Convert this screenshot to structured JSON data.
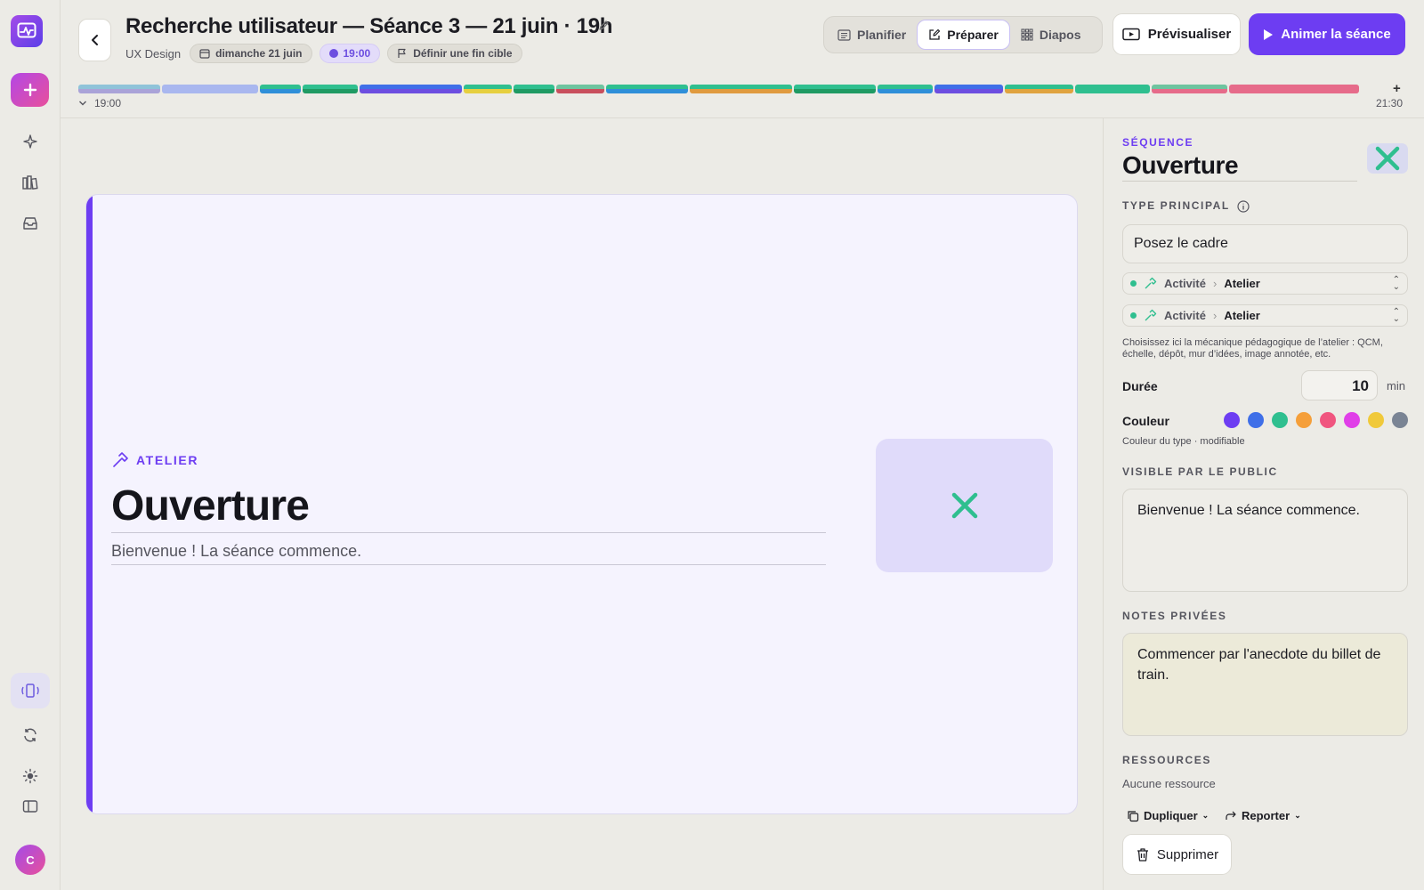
{
  "header": {
    "title": "Recherche utilisateur — Séance 3 — 21 juin · 19h",
    "course": "UX Design",
    "date_chip": "dimanche 21 juin",
    "time_chip": "19:00",
    "target_chip": "Définir une fin cible",
    "modes": [
      {
        "label": "Planifier",
        "icon": "list-icon",
        "active": false
      },
      {
        "label": "Préparer",
        "icon": "edit-icon",
        "active": true
      },
      {
        "label": "Diapos",
        "icon": "grid-icon",
        "active": false
      }
    ],
    "preview_label": "Prévisualiser",
    "animate_label": "Animer la séance"
  },
  "timeline": {
    "start": "19:00",
    "end": "21:30",
    "segments": [
      {
        "top": "#8fc3d9",
        "bottom": "#aaa3d8",
        "weight": 6
      },
      {
        "top": "#a9b7ef",
        "bottom": "#a9b7ef",
        "weight": 7
      },
      {
        "top": "#2fbf8f",
        "bottom": "#2f8fd9",
        "weight": 3
      },
      {
        "top": "#2fbf8f",
        "bottom": "#1f9a63",
        "weight": 4
      },
      {
        "top": "#3f6fe8",
        "bottom": "#6d4ee0",
        "weight": 7.5
      },
      {
        "top": "#2fbf8f",
        "bottom": "#e6cf3f",
        "weight": 3.5
      },
      {
        "top": "#2fbf8f",
        "bottom": "#1f9a63",
        "weight": 3
      },
      {
        "top": "#6ec49f",
        "bottom": "#c94f5d",
        "weight": 3.5
      },
      {
        "top": "#2fbf8f",
        "bottom": "#2f8fd9",
        "weight": 6
      },
      {
        "top": "#2fbf8f",
        "bottom": "#e09a3f",
        "weight": 7.5
      },
      {
        "top": "#2fbf8f",
        "bottom": "#1f9a63",
        "weight": 6
      },
      {
        "top": "#2fbf8f",
        "bottom": "#2f8fd9",
        "weight": 4
      },
      {
        "top": "#3f6fe8",
        "bottom": "#6d4ee0",
        "weight": 5
      },
      {
        "top": "#2fbf8f",
        "bottom": "#e0a33f",
        "weight": 5
      },
      {
        "top": "#2fbf8f",
        "bottom": "#2fbf8f",
        "weight": 5.5
      },
      {
        "top": "#6ec49f",
        "bottom": "#e66b8a",
        "weight": 5.5
      },
      {
        "top": "#e66b8a",
        "bottom": "#e66b8a",
        "weight": 9.5
      }
    ]
  },
  "slide": {
    "type_label": "ATELIER",
    "title": "Ouverture",
    "subtitle": "Bienvenue ! La séance commence.",
    "accent_color": "#6d3df2",
    "media_icon": "close-icon"
  },
  "panel": {
    "section_label": "SÉQUENCE",
    "title": "Ouverture",
    "type_label": "TYPE PRINCIPAL",
    "type_value": "Posez le cadre",
    "selects": [
      {
        "category": "Activité",
        "value": "Atelier"
      },
      {
        "category": "Activité",
        "value": "Atelier"
      }
    ],
    "hint": "Choisissez ici la mécanique pédagogique de l’atelier : QCM, échelle, dépôt, mur d’idées, image annotée, etc.",
    "duration_label": "Durée",
    "duration_value": "10",
    "duration_unit": "min",
    "color_label": "Couleur",
    "colors": [
      "#6d3df2",
      "#3f6fe8",
      "#2fbf8f",
      "#f59f3a",
      "#f0557f",
      "#e03fe8",
      "#f0c93a",
      "#7a8494"
    ],
    "color_hint": "Couleur du type · modifiable",
    "public_label": "VISIBLE PAR LE PUBLIC",
    "public_text": "Bienvenue ! La séance commence.",
    "notes_label": "NOTES PRIVÉES",
    "notes_text": "Commencer par l'anecdote du billet de train.",
    "resources_label": "RESSOURCES",
    "resources_empty": "Aucune ressource",
    "duplicate_label": "Dupliquer",
    "postpone_label": "Reporter",
    "delete_label": "Supprimer"
  },
  "user": {
    "initial": "C"
  }
}
